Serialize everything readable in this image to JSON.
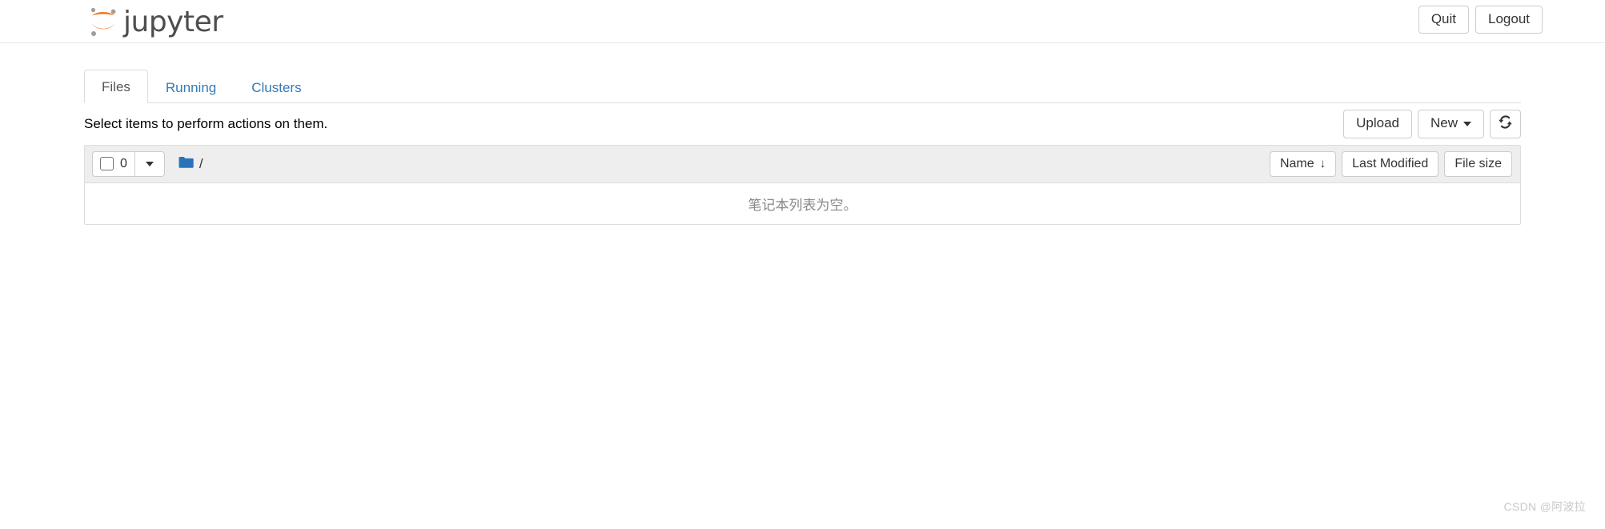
{
  "header": {
    "logo_text": "jupyter",
    "logo_icon": "jupyter-logo-icon",
    "quit_label": "Quit",
    "logout_label": "Logout"
  },
  "tabs": [
    {
      "label": "Files",
      "active": true
    },
    {
      "label": "Running",
      "active": false
    },
    {
      "label": "Clusters",
      "active": false
    }
  ],
  "actions": {
    "note": "Select items to perform actions on them.",
    "upload_label": "Upload",
    "new_label": "New",
    "refresh_icon": "refresh-icon"
  },
  "list_toolbar": {
    "select_all_checkbox": "unchecked",
    "selected_count": "0",
    "dropdown_icon": "chevron-down-icon",
    "folder_icon": "folder-icon",
    "breadcrumb_path": "/",
    "sort_name_label": "Name",
    "sort_name_arrow": "↓",
    "sort_modified_label": "Last Modified",
    "sort_size_label": "File size"
  },
  "file_list": {
    "rows": [],
    "empty_message": "笔记本列表为空。"
  },
  "watermark": {
    "text": "CSDN @阿波拉"
  },
  "colors": {
    "logo_orange": "#f37726",
    "logo_gray": "#9e9e9e",
    "link_blue": "#337ab7",
    "folder_blue": "#2a73ba",
    "toolbar_bg": "#eeeeee",
    "border": "#dddddd"
  }
}
